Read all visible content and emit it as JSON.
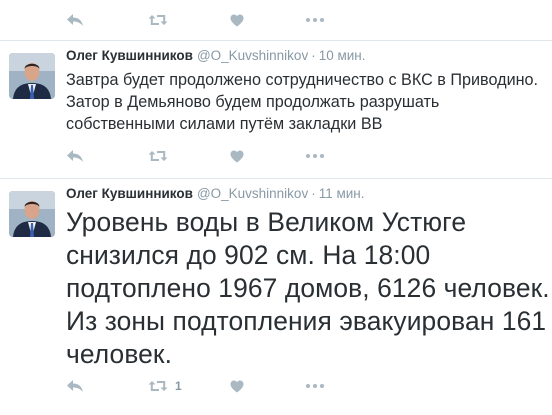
{
  "tweets": [
    {
      "author_name": "",
      "handle": "",
      "time": "",
      "text": "",
      "retweet_count": "",
      "like_count": ""
    },
    {
      "author_name": "Олег Кувшинников",
      "handle": "@O_Kuvshinnikov",
      "time": "10 мин.",
      "text": "Завтра будет продолжено сотрудничество с ВКС в Приводино. Затор в Демьяново будем продолжать разрушать собственными силами путём закладки ВВ",
      "retweet_count": "",
      "like_count": ""
    },
    {
      "author_name": "Олег Кувшинников",
      "handle": "@O_Kuvshinnikov",
      "time": "11 мин.",
      "text": "Уровень воды в Великом Устюге снизился до 902 см. На 18:00 подтоплено 1967 домов, 6126 человек. Из зоны подтопления эвакуирован 161 человек.",
      "retweet_count": "1",
      "like_count": ""
    }
  ],
  "separator": "·",
  "icons": {
    "reply": "reply-icon",
    "retweet": "retweet-icon",
    "like": "heart-icon",
    "more": "more-icon"
  },
  "colors": {
    "icon": "#aab8c2",
    "text": "#292f33",
    "muted": "#8899a6",
    "divider": "#e1e8ed"
  }
}
